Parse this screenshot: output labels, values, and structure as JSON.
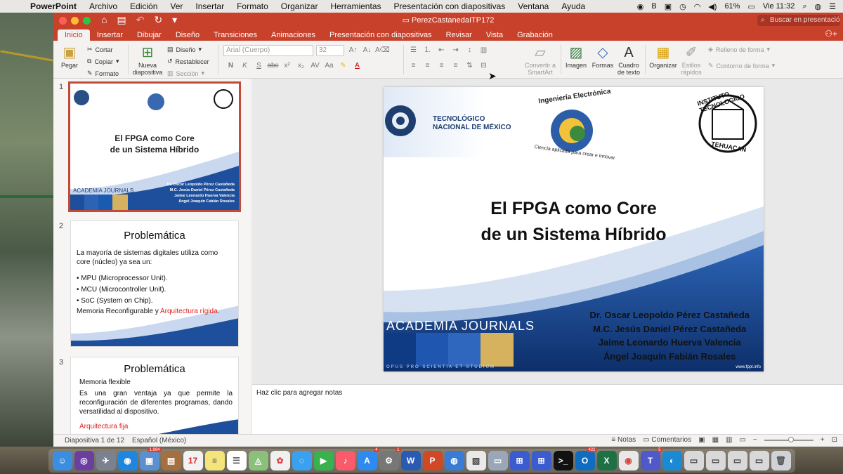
{
  "menubar": {
    "app": "PowerPoint",
    "items": [
      "Archivo",
      "Edición",
      "Ver",
      "Insertar",
      "Formato",
      "Organizar",
      "Herramientas",
      "Presentación con diapositivas",
      "Ventana",
      "Ayuda"
    ],
    "battery": "61%",
    "clock": "Vie 11:32"
  },
  "window": {
    "title": "PerezCastanedaITP172",
    "search_placeholder": "Buscar en presentación"
  },
  "tabs": [
    "Inicio",
    "Insertar",
    "Dibujar",
    "Diseño",
    "Transiciones",
    "Animaciones",
    "Presentación con diapositivas",
    "Revisar",
    "Vista",
    "Grabación"
  ],
  "ribbon": {
    "paste": "Pegar",
    "cut": "Cortar",
    "copy": "Copiar",
    "format_painter": "Formato",
    "new_slide": "Nueva diapositiva",
    "layout": "Diseño",
    "reset": "Restablecer",
    "section": "Sección",
    "font_name": "Arial (Cuerpo)",
    "font_size": "32",
    "convert_smartart": "Convertir a SmartArt",
    "image": "Imagen",
    "shapes": "Formas",
    "textbox": "Cuadro de texto",
    "arrange": "Organizar",
    "quick_styles": "Estilos rápidos",
    "shape_fill": "Relleno de forma",
    "shape_outline": "Contorno de forma"
  },
  "thumbnails": [
    {
      "num": "1",
      "title_line1": "El FPGA como Core",
      "title_line2": "de un Sistema Híbrido",
      "authors": [
        "Dr. Oscar Leopoldo Pérez Castañeda",
        "M.C. Jesús Daniel Pérez Castañeda",
        "Jaime Leonardo Huerva Valencia",
        "Ángel Joaquín Fabián Rosales"
      ],
      "brand": "ACADEMIA JOURNALS"
    },
    {
      "num": "2",
      "title": "Problemática",
      "intro": "La mayoría de sistemas digitales utiliza como core (núcleo) ya sea un:",
      "bullets": [
        "MPU (Microprocessor Unit).",
        "MCU (Microcontroller Unit).",
        "SoC (System on Chip)."
      ],
      "footer_black": "Memoria Reconfigurable y ",
      "footer_red": "Arquitectura rígida",
      "footer_end": "."
    },
    {
      "num": "3",
      "title": "Problemática",
      "sub": "Memoria flexible",
      "body": "Es una gran ventaja ya que permite la reconfiguración de diferentes programas, dando versatilidad al dispositivo.",
      "red": "Arquitectura fija"
    }
  ],
  "slide": {
    "tec_line1": "TECNOLÓGICO",
    "tec_line2": "NACIONAL DE MÉXICO",
    "ing_arc": "Ingeniería Electrónica",
    "ing_sub": "Ciencia aplicada para crear e innovar",
    "itt_arc": "INSTITUTO TECNOLOGICO",
    "itt_bottom": "TEHUACAN",
    "title_line1": "El FPGA como Core",
    "title_line2": "de un Sistema Híbrido",
    "authors": [
      "Dr. Oscar Leopoldo Pérez Castañeda",
      "M.C. Jesús Daniel Pérez Castañeda",
      "Jaime Leonardo Huerva Valencia",
      "Ángel Joaquín Fabián Rosales"
    ],
    "brand": "ACADEMIA JOURNALS",
    "motto": "OPUS PRO SCIENTIA ET STUDIUM",
    "url": "www.fppt.info"
  },
  "notes": {
    "placeholder": "Haz clic para agregar notas"
  },
  "status": {
    "slide_count": "Diapositiva 1 de 12",
    "language": "Español (México)",
    "notes": "Notas",
    "comments": "Comentarios"
  },
  "dock": {
    "badges": [
      "1.994",
      "4",
      "1",
      "422",
      "5"
    ]
  },
  "colors": {
    "accent": "#c8412b",
    "slide_blue": "#1d4f9c",
    "gold": "#d6b25e"
  }
}
